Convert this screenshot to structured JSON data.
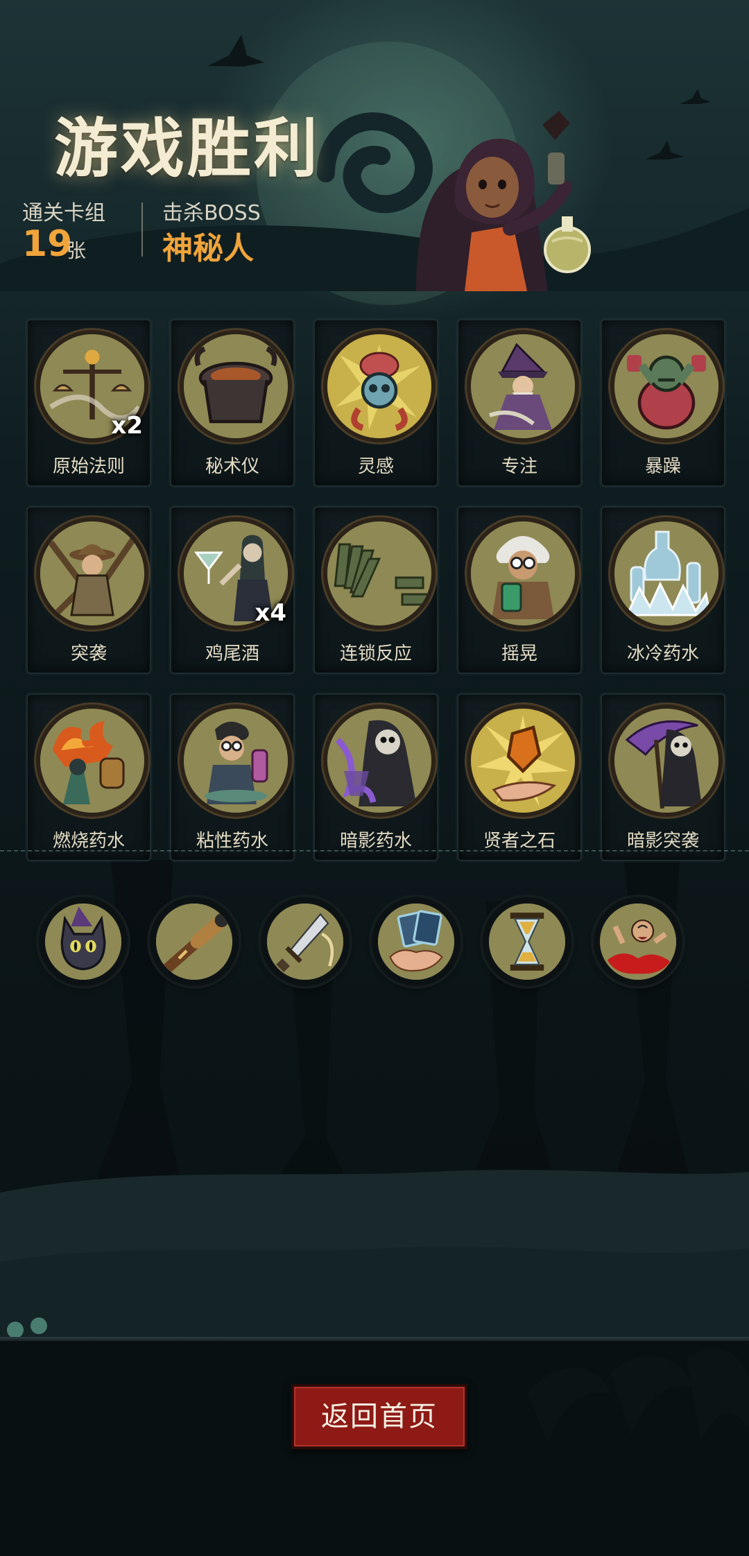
{
  "header": {
    "title": "游戏胜利",
    "deck_label": "通关卡组",
    "deck_count": "19",
    "deck_unit": "张",
    "boss_label": "击杀BOSS",
    "boss_name": "神秘人"
  },
  "cards": [
    {
      "name": "原始法则",
      "count": "x2",
      "icon": "scales-icon",
      "color": "#8f8955"
    },
    {
      "name": "秘术仪",
      "count": "",
      "icon": "altar-icon",
      "color": "#8f8955"
    },
    {
      "name": "灵感",
      "count": "",
      "icon": "skull-brain-icon",
      "color": "#c8b04a"
    },
    {
      "name": "专注",
      "count": "",
      "icon": "wizard-icon",
      "color": "#8f8955"
    },
    {
      "name": "暴躁",
      "count": "",
      "icon": "brute-icon",
      "color": "#8f8955"
    },
    {
      "name": "突袭",
      "count": "",
      "icon": "adventurer-icon",
      "color": "#8f8955"
    },
    {
      "name": "鸡尾酒",
      "count": "x4",
      "icon": "cocktail-icon",
      "color": "#8f8955"
    },
    {
      "name": "连锁反应",
      "count": "",
      "icon": "dominoes-icon",
      "color": "#8f8955"
    },
    {
      "name": "摇晃",
      "count": "",
      "icon": "scientist-icon",
      "color": "#8f8955"
    },
    {
      "name": "冰冷药水",
      "count": "",
      "icon": "ice-bottles-icon",
      "color": "#8f8955"
    },
    {
      "name": "燃烧药水",
      "count": "",
      "icon": "fire-potion-icon",
      "color": "#8f8955"
    },
    {
      "name": "粘性药水",
      "count": "",
      "icon": "alchemist-icon",
      "color": "#8f8955"
    },
    {
      "name": "暗影药水",
      "count": "",
      "icon": "reaper-icon",
      "color": "#8f8955"
    },
    {
      "name": "贤者之石",
      "count": "",
      "icon": "crystal-icon",
      "color": "#c8b04a"
    },
    {
      "name": "暗影突袭",
      "count": "",
      "icon": "scythe-reaper-icon",
      "color": "#8f8955"
    }
  ],
  "relics": [
    {
      "icon": "cat-icon",
      "color": "#8f8955"
    },
    {
      "icon": "spyglass-icon",
      "color": "#8f8955"
    },
    {
      "icon": "dagger-icon",
      "color": "#8f8955"
    },
    {
      "icon": "card-hand-icon",
      "color": "#8f8955"
    },
    {
      "icon": "hourglass-icon",
      "color": "#8f8955"
    },
    {
      "icon": "blood-man-icon",
      "color": "#8f8955"
    }
  ],
  "footer": {
    "home_button": "返回首页"
  },
  "colors": {
    "accent_gold": "#f0a43a",
    "button_red": "#8e1a16"
  }
}
